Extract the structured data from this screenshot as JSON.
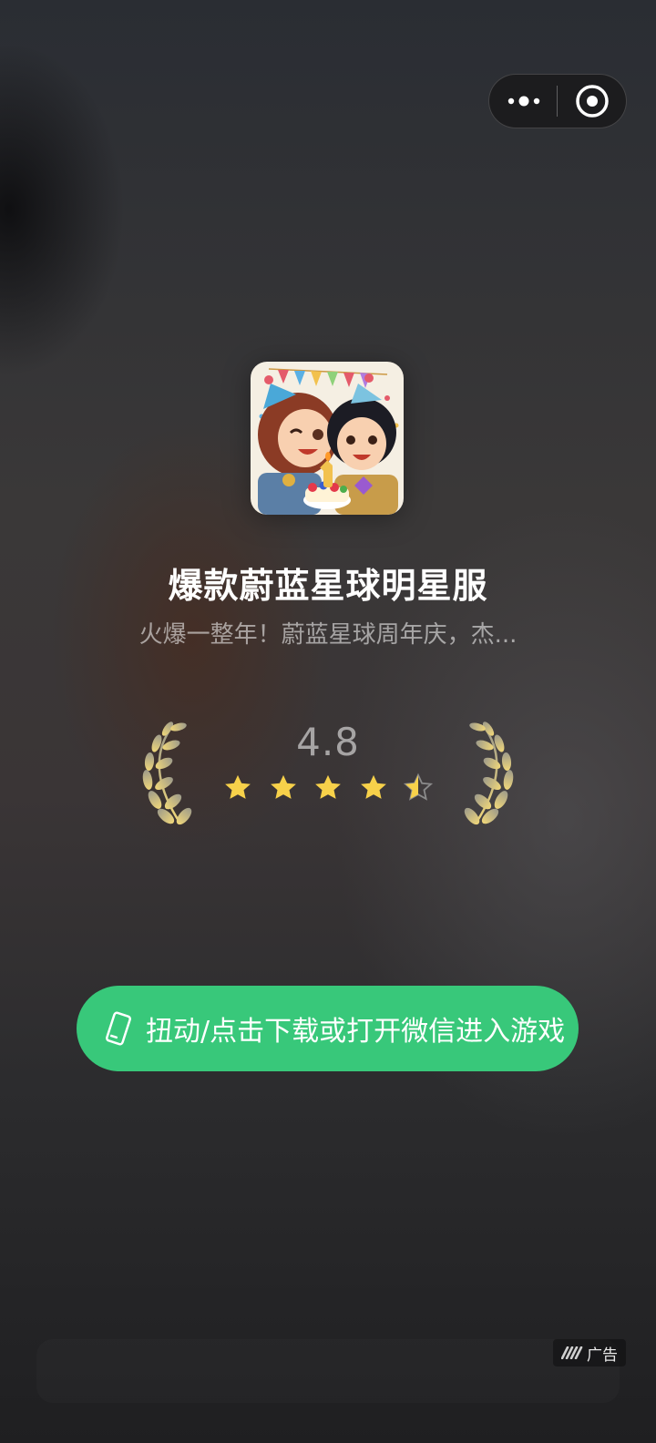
{
  "capsule": {
    "more_icon": "more-dots-icon",
    "close_icon": "close-target-icon"
  },
  "app": {
    "icon": "game-app-icon",
    "title": "爆款蔚蓝星球明星服",
    "subtitle": "火爆一整年！蔚蓝星球周年庆，杰..."
  },
  "rating": {
    "score": "4.8",
    "value": 4.8,
    "max": 5,
    "star_color": "#f7d14a",
    "laurel_color": "#e8d8a0"
  },
  "cta": {
    "label": "扭动/点击下载或打开微信进入游戏",
    "icon": "phone-shake-icon",
    "color": "#38c87a"
  },
  "ad": {
    "label": "广告",
    "icon": "ad-logo-icon"
  }
}
